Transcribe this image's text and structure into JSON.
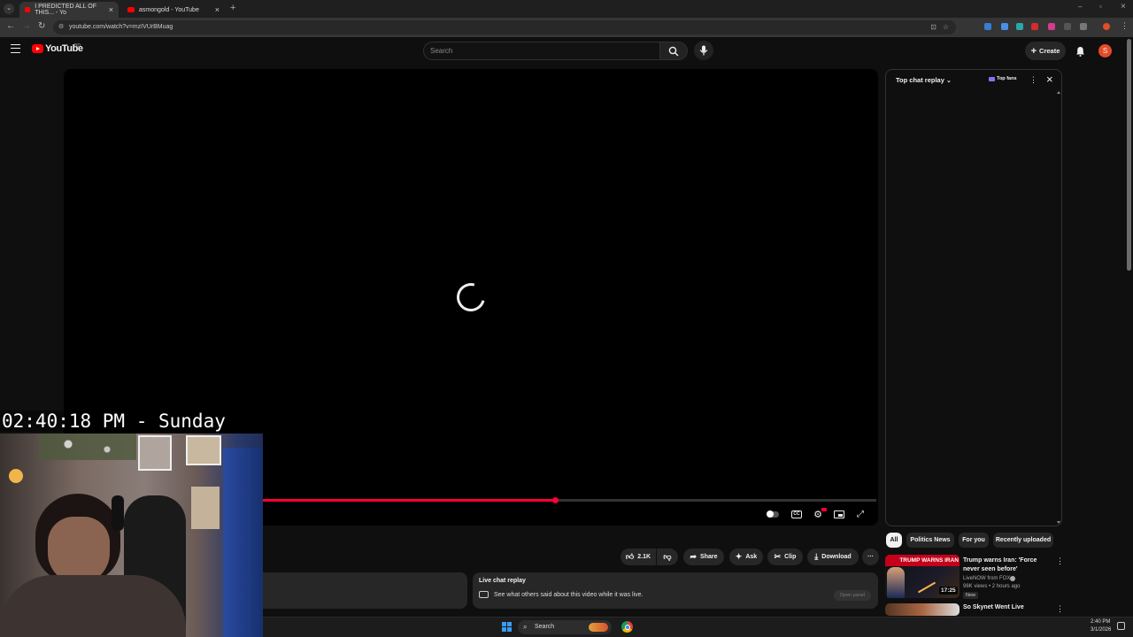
{
  "browser": {
    "tabs": [
      {
        "title": "I PREDICTED ALL OF THIS... - Yo",
        "active": true
      },
      {
        "title": "asmongold - YouTube",
        "active": false
      }
    ],
    "url": "youtube.com/watch?v=mzIVUrBMuag"
  },
  "header": {
    "logo_text": "YouTube",
    "country_code": "BD",
    "search_placeholder": "Search",
    "create_label": "Create",
    "avatar_letter": "S"
  },
  "player": {
    "progress_fraction": 0.605
  },
  "actions": {
    "like_count": "2.1K",
    "share": "Share",
    "ask": "Ask",
    "clip": "Clip",
    "download": "Download"
  },
  "chat_replay_box": {
    "title": "Live chat replay",
    "text": "See what others said about this video while it was live.",
    "button": "Open panel"
  },
  "chat_panel": {
    "title": "Top chat replay",
    "badge": "Top fans"
  },
  "chips": [
    "All",
    "Politics News",
    "For you",
    "Recently uploaded"
  ],
  "recommendations": [
    {
      "thumb_text": "TRUMP WARNS IRAN",
      "duration": "17:25",
      "title": "Trump warns Iran: 'Force never seen before'",
      "channel": "LiveNOW from FOX",
      "meta": "98K views • 2 hours ago",
      "badge": "New"
    },
    {
      "title": "So Skynet Went Live"
    }
  ],
  "overlay": {
    "clock": "02:40:18 PM - Sunday"
  },
  "taskbar": {
    "search": "Search",
    "time": "2:40 PM",
    "date": "3/1/2026"
  },
  "colors": {
    "accent_red": "#ff0033",
    "yt_red": "#ff0000",
    "bg": "#0f0f0f"
  }
}
